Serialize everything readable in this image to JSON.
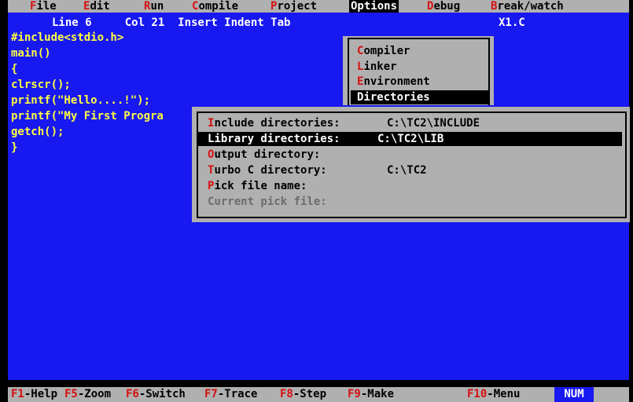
{
  "menu": [
    {
      "hot": "F",
      "rest": "ile"
    },
    {
      "hot": "E",
      "rest": "dit"
    },
    {
      "hot": "R",
      "rest": "un"
    },
    {
      "hot": "C",
      "rest": "ompile"
    },
    {
      "hot": "P",
      "rest": "roject"
    },
    {
      "hot": "",
      "rest": "Options"
    },
    {
      "hot": "D",
      "rest": "ebug"
    },
    {
      "hot": "B",
      "rest": "reak/watch"
    }
  ],
  "editor": {
    "status": "Line 6     Col 21  Insert Indent Tab",
    "filename": "X1.C",
    "lines": [
      "#include<stdio.h>",
      "main()",
      "{",
      "clrscr();",
      "printf(\"Hello....!\");",
      "printf(\"My First Progra",
      "getch();",
      "}"
    ]
  },
  "options_menu": [
    {
      "hot": "C",
      "rest": "ompiler"
    },
    {
      "hot": "L",
      "rest": "inker"
    },
    {
      "hot": "E",
      "rest": "nvironment"
    },
    {
      "hot": "",
      "rest": "Directories"
    }
  ],
  "directories": [
    {
      "hot": "I",
      "rest": "nclude directories:",
      "value": "C:\\TC2\\INCLUDE"
    },
    {
      "hot": "",
      "rest": "Library directories:",
      "value": "C:\\TC2\\LIB"
    },
    {
      "hot": "O",
      "rest": "utput directory:",
      "value": ""
    },
    {
      "hot": "T",
      "rest": "urbo C directory:",
      "value": "C:\\TC2"
    },
    {
      "hot": "P",
      "rest": "ick file name:",
      "value": ""
    },
    {
      "hot": "",
      "rest": "Current pick file:",
      "value": ""
    }
  ],
  "fkeys": [
    {
      "key": "F1",
      "label": "-Help"
    },
    {
      "key": "F5",
      "label": "-Zoom"
    },
    {
      "key": "F6",
      "label": "-Switch"
    },
    {
      "key": "F7",
      "label": "-Trace"
    },
    {
      "key": "F8",
      "label": "-Step"
    },
    {
      "key": "F9",
      "label": "-Make"
    },
    {
      "key": "F10",
      "label": "-Menu"
    }
  ],
  "num_indicator": "NUM"
}
